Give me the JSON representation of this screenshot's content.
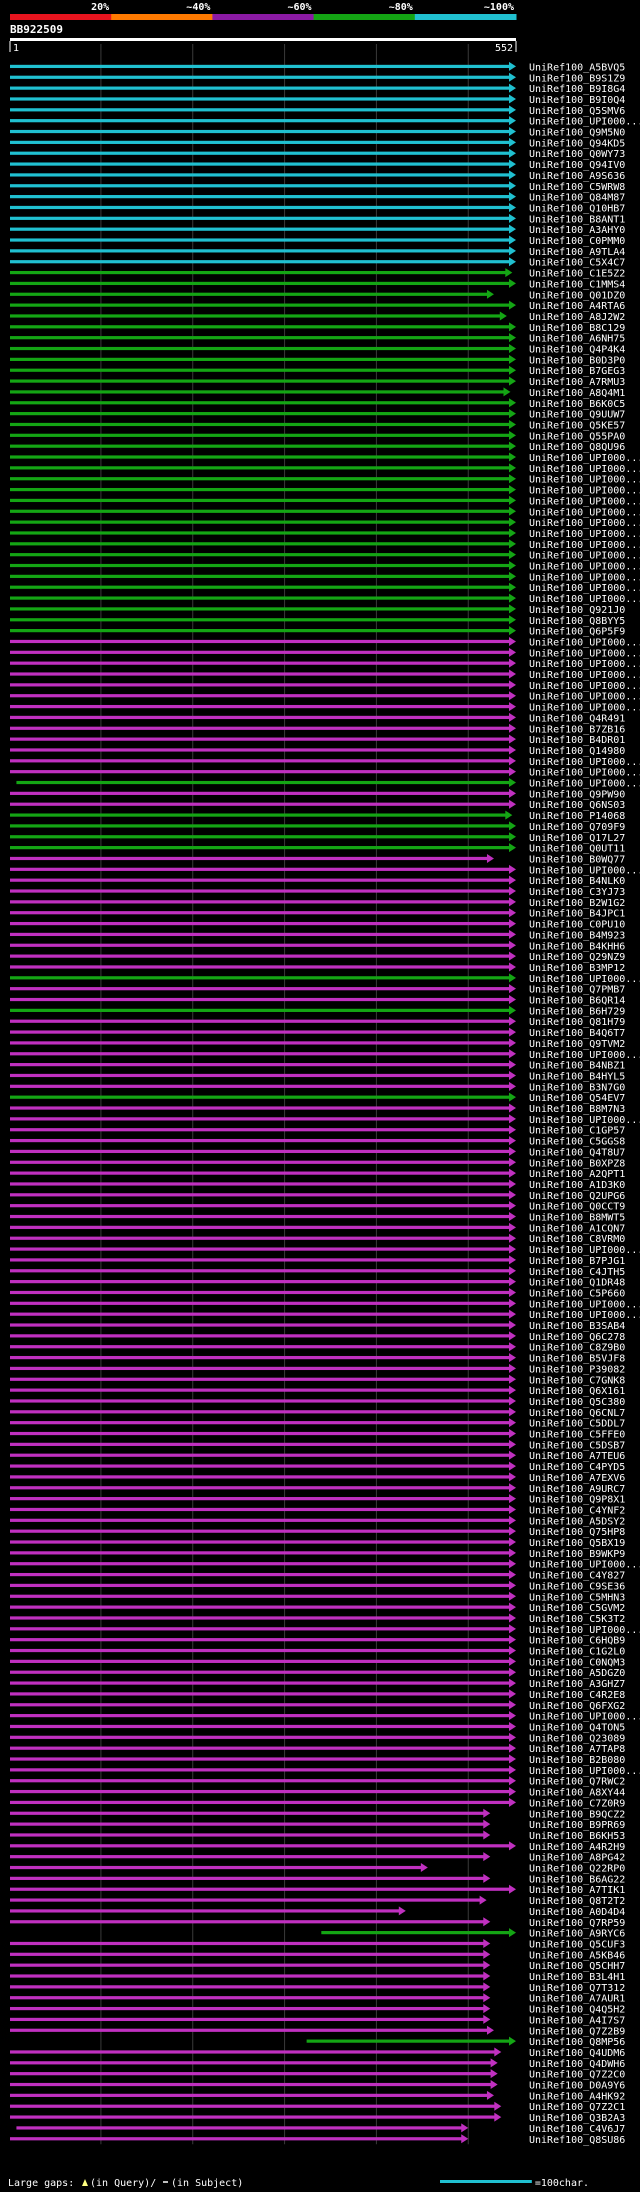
{
  "chart_data": {
    "type": "bar",
    "title": "BB922509",
    "query_start_label": "1",
    "query_end_label": "552",
    "query_length": 552,
    "identity_scale": {
      "labels": [
        "20%",
        "~40%",
        "~60%",
        "~80%",
        "~100%"
      ],
      "colors": [
        "#e8141e",
        "#ff7a00",
        "#8c1aa5",
        "#14a514",
        "#20c0d0"
      ]
    },
    "category_colors": {
      "c": "#20c0d0",
      "g": "#14a514",
      "m": "#c030c0"
    },
    "hits": [
      [
        "UniRef100_A5BVQ5",
        "c",
        1,
        552
      ],
      [
        "UniRef100_B9S1Z9",
        "c",
        1,
        552
      ],
      [
        "UniRef100_B9I8G4",
        "c",
        1,
        552
      ],
      [
        "UniRef100_B9I0Q4",
        "c",
        1,
        552
      ],
      [
        "UniRef100_Q5SMV6",
        "c",
        1,
        552
      ],
      [
        "UniRef100_UPI000...",
        "c",
        1,
        552
      ],
      [
        "UniRef100_Q9M5N0",
        "c",
        1,
        552
      ],
      [
        "UniRef100_Q94KD5",
        "c",
        1,
        552
      ],
      [
        "UniRef100_Q0WY73",
        "c",
        1,
        552
      ],
      [
        "UniRef100_Q94IV0",
        "c",
        1,
        552
      ],
      [
        "UniRef100_A9S636",
        "c",
        1,
        552
      ],
      [
        "UniRef100_C5WRW8",
        "c",
        1,
        552
      ],
      [
        "UniRef100_Q84M87",
        "c",
        1,
        552
      ],
      [
        "UniRef100_Q10HB7",
        "c",
        1,
        552
      ],
      [
        "UniRef100_B8ANT1",
        "c",
        1,
        552
      ],
      [
        "UniRef100_A3AHY0",
        "c",
        1,
        552
      ],
      [
        "UniRef100_C0PMM0",
        "c",
        1,
        552
      ],
      [
        "UniRef100_A9TLA4",
        "c",
        1,
        552
      ],
      [
        "UniRef100_C5X4C7",
        "c",
        1,
        552
      ],
      [
        "UniRef100_C1E5Z2",
        "g",
        1,
        548
      ],
      [
        "UniRef100_C1MMS4",
        "g",
        1,
        552
      ],
      [
        "UniRef100_Q01DZ0",
        "g",
        1,
        528
      ],
      [
        "UniRef100_A4RTA6",
        "g",
        1,
        552
      ],
      [
        "UniRef100_A8J2W2",
        "g",
        1,
        542
      ],
      [
        "UniRef100_B8C129",
        "g",
        1,
        552
      ],
      [
        "UniRef100_A6NH75",
        "g",
        1,
        552
      ],
      [
        "UniRef100_Q4P4K4",
        "g",
        1,
        552
      ],
      [
        "UniRef100_B0D3P0",
        "g",
        1,
        552
      ],
      [
        "UniRef100_B7GEG3",
        "g",
        1,
        552
      ],
      [
        "UniRef100_A7RMU3",
        "g",
        1,
        552
      ],
      [
        "UniRef100_A8Q4M1",
        "g",
        1,
        546
      ],
      [
        "UniRef100_B6K0C5",
        "g",
        1,
        552
      ],
      [
        "UniRef100_Q9UUW7",
        "g",
        1,
        552
      ],
      [
        "UniRef100_Q5KE57",
        "g",
        1,
        552
      ],
      [
        "UniRef100_Q55PA0",
        "g",
        1,
        552
      ],
      [
        "UniRef100_Q8QU96",
        "g",
        1,
        552
      ],
      [
        "UniRef100_UPI000...",
        "g",
        1,
        552
      ],
      [
        "UniRef100_UPI000...",
        "g",
        1,
        552
      ],
      [
        "UniRef100_UPI000...",
        "g",
        1,
        552
      ],
      [
        "UniRef100_UPI000...",
        "g",
        1,
        552
      ],
      [
        "UniRef100_UPI000...",
        "g",
        1,
        552
      ],
      [
        "UniRef100_UPI000...",
        "g",
        1,
        552
      ],
      [
        "UniRef100_UPI000...",
        "g",
        1,
        552
      ],
      [
        "UniRef100_UPI000...",
        "g",
        1,
        552
      ],
      [
        "UniRef100_UPI000...",
        "g",
        1,
        552
      ],
      [
        "UniRef100_UPI000...",
        "g",
        1,
        552
      ],
      [
        "UniRef100_UPI000...",
        "g",
        1,
        552
      ],
      [
        "UniRef100_UPI000...",
        "g",
        1,
        552
      ],
      [
        "UniRef100_UPI000...",
        "g",
        1,
        552
      ],
      [
        "UniRef100_UPI000...",
        "g",
        1,
        552
      ],
      [
        "UniRef100_Q921J0",
        "g",
        1,
        552
      ],
      [
        "UniRef100_Q8BYY5",
        "g",
        1,
        552
      ],
      [
        "UniRef100_Q6P5F9",
        "g",
        1,
        552
      ],
      [
        "UniRef100_UPI000...",
        "m",
        1,
        552
      ],
      [
        "UniRef100_UPI000...",
        "m",
        1,
        552
      ],
      [
        "UniRef100_UPI000...",
        "m",
        1,
        552
      ],
      [
        "UniRef100_UPI000...",
        "m",
        1,
        552
      ],
      [
        "UniRef100_UPI000...",
        "m",
        1,
        552
      ],
      [
        "UniRef100_UPI000...",
        "m",
        1,
        552
      ],
      [
        "UniRef100_UPI000...",
        "m",
        1,
        552
      ],
      [
        "UniRef100_Q4R491",
        "m",
        1,
        552
      ],
      [
        "UniRef100_B7ZB16",
        "m",
        1,
        552
      ],
      [
        "UniRef100_B4DR01",
        "m",
        1,
        552
      ],
      [
        "UniRef100_Q14980",
        "m",
        1,
        552
      ],
      [
        "UniRef100_UPI000...",
        "m",
        1,
        552
      ],
      [
        "UniRef100_UPI000...",
        "m",
        1,
        552
      ],
      [
        "UniRef100_UPI000...",
        "g",
        8,
        552
      ],
      [
        "UniRef100_Q9PW90",
        "m",
        1,
        552
      ],
      [
        "UniRef100_Q6NS03",
        "m",
        1,
        552
      ],
      [
        "UniRef100_P14068",
        "g",
        1,
        548
      ],
      [
        "UniRef100_Q709F9",
        "g",
        1,
        552
      ],
      [
        "UniRef100_Q17L27",
        "g",
        1,
        552
      ],
      [
        "UniRef100_Q0UT11",
        "g",
        1,
        552
      ],
      [
        "UniRef100_B0WQ77",
        "m",
        1,
        528
      ],
      [
        "UniRef100_UPI000...",
        "m",
        1,
        552
      ],
      [
        "UniRef100_B4NLK0",
        "m",
        1,
        552
      ],
      [
        "UniRef100_C3YJ73",
        "m",
        1,
        552
      ],
      [
        "UniRef100_B2W1G2",
        "m",
        1,
        552
      ],
      [
        "UniRef100_B4JPC1",
        "m",
        1,
        552
      ],
      [
        "UniRef100_C0PU10",
        "m",
        1,
        552
      ],
      [
        "UniRef100_B4M923",
        "m",
        1,
        552
      ],
      [
        "UniRef100_B4KHH6",
        "m",
        1,
        552
      ],
      [
        "UniRef100_Q29NZ9",
        "m",
        1,
        552
      ],
      [
        "UniRef100_B3MP12",
        "m",
        1,
        552
      ],
      [
        "UniRef100_UPI000...",
        "g",
        1,
        552
      ],
      [
        "UniRef100_Q7PMB7",
        "m",
        1,
        552
      ],
      [
        "UniRef100_B6QR14",
        "m",
        1,
        552
      ],
      [
        "UniRef100_B6H729",
        "g",
        1,
        552
      ],
      [
        "UniRef100_Q81H79",
        "m",
        1,
        552
      ],
      [
        "UniRef100_B4Q6T7",
        "m",
        1,
        552
      ],
      [
        "UniRef100_Q9TVM2",
        "m",
        1,
        552
      ],
      [
        "UniRef100_UPI000...",
        "m",
        1,
        552
      ],
      [
        "UniRef100_B4NBZ1",
        "m",
        1,
        552
      ],
      [
        "UniRef100_B4HYL5",
        "m",
        1,
        552
      ],
      [
        "UniRef100_B3N7G0",
        "m",
        1,
        552
      ],
      [
        "UniRef100_Q54EV7",
        "g",
        1,
        552
      ],
      [
        "UniRef100_B8M7N3",
        "m",
        1,
        552
      ],
      [
        "UniRef100_UPI000...",
        "m",
        1,
        552
      ],
      [
        "UniRef100_C1GP57",
        "m",
        1,
        552
      ],
      [
        "UniRef100_C5GGS8",
        "m",
        1,
        552
      ],
      [
        "UniRef100_Q4T8U7",
        "m",
        1,
        552
      ],
      [
        "UniRef100_B0XPZ8",
        "m",
        1,
        552
      ],
      [
        "UniRef100_A2QPT1",
        "m",
        1,
        552
      ],
      [
        "UniRef100_A1D3K0",
        "m",
        1,
        552
      ],
      [
        "UniRef100_Q2UPG6",
        "m",
        1,
        552
      ],
      [
        "UniRef100_Q0CCT9",
        "m",
        1,
        552
      ],
      [
        "UniRef100_B8MWT5",
        "m",
        1,
        552
      ],
      [
        "UniRef100_A1CQN7",
        "m",
        1,
        552
      ],
      [
        "UniRef100_C8VRM0",
        "m",
        1,
        552
      ],
      [
        "UniRef100_UPI000...",
        "m",
        1,
        552
      ],
      [
        "UniRef100_B7PJG1",
        "m",
        1,
        552
      ],
      [
        "UniRef100_C4JTH5",
        "m",
        1,
        552
      ],
      [
        "UniRef100_Q1DR48",
        "m",
        1,
        552
      ],
      [
        "UniRef100_C5P660",
        "m",
        1,
        552
      ],
      [
        "UniRef100_UPI000...",
        "m",
        1,
        552
      ],
      [
        "UniRef100_UPI000...",
        "m",
        1,
        552
      ],
      [
        "UniRef100_B3SAB4",
        "m",
        1,
        552
      ],
      [
        "UniRef100_Q6C278",
        "m",
        1,
        552
      ],
      [
        "UniRef100_C8Z9B0",
        "m",
        1,
        552
      ],
      [
        "UniRef100_B5VJF8",
        "m",
        1,
        552
      ],
      [
        "UniRef100_P39082",
        "m",
        1,
        552
      ],
      [
        "UniRef100_C7GNK8",
        "m",
        1,
        552
      ],
      [
        "UniRef100_Q6X161",
        "m",
        1,
        552
      ],
      [
        "UniRef100_Q5C380",
        "m",
        1,
        552
      ],
      [
        "UniRef100_Q6CNL7",
        "m",
        1,
        552
      ],
      [
        "UniRef100_C5DDL7",
        "m",
        1,
        552
      ],
      [
        "UniRef100_C5FFE0",
        "m",
        1,
        552
      ],
      [
        "UniRef100_C5DSB7",
        "m",
        1,
        552
      ],
      [
        "UniRef100_A7TEU6",
        "m",
        1,
        552
      ],
      [
        "UniRef100_C4PYD5",
        "m",
        1,
        552
      ],
      [
        "UniRef100_A7EXV6",
        "m",
        1,
        552
      ],
      [
        "UniRef100_A9URC7",
        "m",
        1,
        552
      ],
      [
        "UniRef100_Q9P8X1",
        "m",
        1,
        552
      ],
      [
        "UniRef100_C4YNF2",
        "m",
        1,
        552
      ],
      [
        "UniRef100_A5DSY2",
        "m",
        1,
        552
      ],
      [
        "UniRef100_Q75HP8",
        "m",
        1,
        552
      ],
      [
        "UniRef100_Q5BX19",
        "m",
        1,
        552
      ],
      [
        "UniRef100_B9WKP9",
        "m",
        1,
        552
      ],
      [
        "UniRef100_UPI000...",
        "m",
        1,
        552
      ],
      [
        "UniRef100_C4Y827",
        "m",
        1,
        552
      ],
      [
        "UniRef100_C9SE36",
        "m",
        1,
        552
      ],
      [
        "UniRef100_C5MHN3",
        "m",
        1,
        552
      ],
      [
        "UniRef100_C5GVM2",
        "m",
        1,
        552
      ],
      [
        "UniRef100_C5K3T2",
        "m",
        1,
        552
      ],
      [
        "UniRef100_UPI000...",
        "m",
        1,
        552
      ],
      [
        "UniRef100_C6HQB9",
        "m",
        1,
        552
      ],
      [
        "UniRef100_C1G2L0",
        "m",
        1,
        552
      ],
      [
        "UniRef100_C0NQM3",
        "m",
        1,
        552
      ],
      [
        "UniRef100_A5DGZ0",
        "m",
        1,
        552
      ],
      [
        "UniRef100_A3GHZ7",
        "m",
        1,
        552
      ],
      [
        "UniRef100_C4R2E8",
        "m",
        1,
        552
      ],
      [
        "UniRef100_Q6FXG2",
        "m",
        1,
        552
      ],
      [
        "UniRef100_UPI000...",
        "m",
        1,
        552
      ],
      [
        "UniRef100_Q4TON5",
        "m",
        1,
        552
      ],
      [
        "UniRef100_Q23089",
        "m",
        1,
        552
      ],
      [
        "UniRef100_A7TAP8",
        "m",
        1,
        552
      ],
      [
        "UniRef100_B2B080",
        "m",
        1,
        552
      ],
      [
        "UniRef100_UPI000...",
        "m",
        1,
        552
      ],
      [
        "UniRef100_Q7RWC2",
        "m",
        1,
        552
      ],
      [
        "UniRef100_A8XY44",
        "m",
        1,
        552
      ],
      [
        "UniRef100_C7Z0R9",
        "m",
        1,
        552
      ],
      [
        "UniRef100_B9QCZ2",
        "m",
        1,
        524
      ],
      [
        "UniRef100_B9PR69",
        "m",
        1,
        524
      ],
      [
        "UniRef100_B6KH53",
        "m",
        1,
        524
      ],
      [
        "UniRef100_A4R2H9",
        "m",
        1,
        552
      ],
      [
        "UniRef100_A8PG42",
        "m",
        1,
        524
      ],
      [
        "UniRef100_Q22RP0",
        "m",
        1,
        456
      ],
      [
        "UniRef100_B6AG22",
        "m",
        1,
        524
      ],
      [
        "UniRef100_A7TIK1",
        "m",
        1,
        552
      ],
      [
        "UniRef100_Q8T2T2",
        "m",
        1,
        520
      ],
      [
        "UniRef100_A0D4D4",
        "m",
        1,
        432
      ],
      [
        "UniRef100_Q7RP59",
        "m",
        1,
        524
      ],
      [
        "UniRef100_A9RYC6",
        "g",
        340,
        552
      ],
      [
        "UniRef100_Q5CUF3",
        "m",
        1,
        524
      ],
      [
        "UniRef100_A5KB46",
        "m",
        1,
        524
      ],
      [
        "UniRef100_Q5CHH7",
        "m",
        1,
        524
      ],
      [
        "UniRef100_B3L4H1",
        "m",
        1,
        524
      ],
      [
        "UniRef100_Q7T312",
        "m",
        1,
        524
      ],
      [
        "UniRef100_A7AUR1",
        "m",
        1,
        524
      ],
      [
        "UniRef100_Q4Q5H2",
        "m",
        1,
        524
      ],
      [
        "UniRef100_A4I7S7",
        "m",
        1,
        524
      ],
      [
        "UniRef100_Q7Z2B9",
        "m",
        1,
        528
      ],
      [
        "UniRef100_Q8MP56",
        "g",
        324,
        552
      ],
      [
        "UniRef100_Q4UDM6",
        "m",
        1,
        536
      ],
      [
        "UniRef100_Q4DWH6",
        "m",
        1,
        532
      ],
      [
        "UniRef100_Q7Z2C0",
        "m",
        1,
        532
      ],
      [
        "UniRef100_D0A9Y6",
        "m",
        1,
        532
      ],
      [
        "UniRef100_A4HK92",
        "m",
        1,
        528
      ],
      [
        "UniRef100_Q7Z2C1",
        "m",
        1,
        536
      ],
      [
        "UniRef100_Q3B2A3",
        "m",
        1,
        536
      ],
      [
        "UniRef100_C4V6J7",
        "m",
        8,
        500
      ],
      [
        "UniRef100_Q8SU86",
        "m",
        1,
        500
      ]
    ],
    "footer": {
      "legend_prefix": "Large gaps: ",
      "legend_query": "(in Query)",
      "legend_subject": "(in Subject)",
      "scale_text": "=100char."
    }
  }
}
